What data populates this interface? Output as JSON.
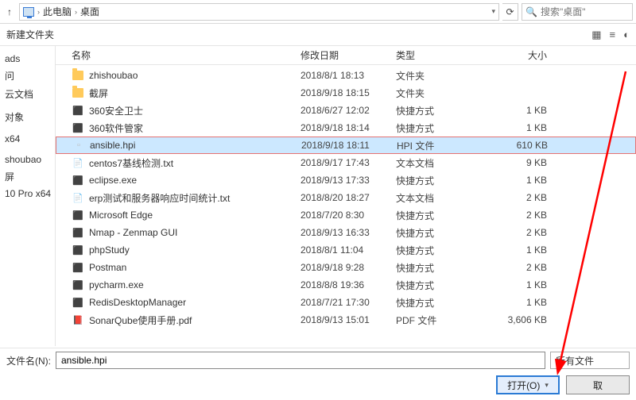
{
  "addressbar": {
    "root": "此电脑",
    "folder": "桌面",
    "search_placeholder": "搜索\"桌面\""
  },
  "toolbar": {
    "new_folder": "新建文件夹"
  },
  "sidebar": {
    "items": [
      "ads",
      "问",
      "云文档",
      "",
      "对象",
      "",
      "x64",
      "",
      "shoubao",
      "屏",
      " 10 Pro x64"
    ]
  },
  "columns": {
    "name": "名称",
    "date": "修改日期",
    "type": "类型",
    "size": "大小"
  },
  "files": [
    {
      "icon": "folder",
      "name": "zhishoubao",
      "date": "2018/8/1 18:13",
      "type": "文件夹",
      "size": ""
    },
    {
      "icon": "folder",
      "name": "截屏",
      "date": "2018/9/18 18:15",
      "type": "文件夹",
      "size": ""
    },
    {
      "icon": "app",
      "name": "360安全卫士",
      "date": "2018/6/27 12:02",
      "type": "快捷方式",
      "size": "1 KB"
    },
    {
      "icon": "app",
      "name": "360软件管家",
      "date": "2018/9/18 18:14",
      "type": "快捷方式",
      "size": "1 KB"
    },
    {
      "icon": "hpi",
      "name": "ansible.hpi",
      "date": "2018/9/18 18:11",
      "type": "HPI 文件",
      "size": "610 KB",
      "selected": true
    },
    {
      "icon": "txt",
      "name": "centos7基线检测.txt",
      "date": "2018/9/17 17:43",
      "type": "文本文档",
      "size": "9 KB"
    },
    {
      "icon": "app",
      "name": "eclipse.exe",
      "date": "2018/9/13 17:33",
      "type": "快捷方式",
      "size": "1 KB"
    },
    {
      "icon": "txt",
      "name": "erp测试和服务器响应时间统计.txt",
      "date": "2018/8/20 18:27",
      "type": "文本文档",
      "size": "2 KB"
    },
    {
      "icon": "app",
      "name": "Microsoft Edge",
      "date": "2018/7/20 8:30",
      "type": "快捷方式",
      "size": "2 KB"
    },
    {
      "icon": "app",
      "name": "Nmap - Zenmap GUI",
      "date": "2018/9/13 16:33",
      "type": "快捷方式",
      "size": "2 KB"
    },
    {
      "icon": "app",
      "name": "phpStudy",
      "date": "2018/8/1 11:04",
      "type": "快捷方式",
      "size": "1 KB"
    },
    {
      "icon": "app",
      "name": "Postman",
      "date": "2018/9/18 9:28",
      "type": "快捷方式",
      "size": "2 KB"
    },
    {
      "icon": "app",
      "name": "pycharm.exe",
      "date": "2018/8/8 19:36",
      "type": "快捷方式",
      "size": "1 KB"
    },
    {
      "icon": "app",
      "name": "RedisDesktopManager",
      "date": "2018/7/21 17:30",
      "type": "快捷方式",
      "size": "1 KB"
    },
    {
      "icon": "pdf",
      "name": "SonarQube使用手册.pdf",
      "date": "2018/9/13 15:01",
      "type": "PDF 文件",
      "size": "3,606 KB"
    }
  ],
  "footer": {
    "filename_label": "文件名(N):",
    "filename_value": "ansible.hpi",
    "filter_label": "所有文件",
    "open_btn": "打开(O)",
    "cancel_btn": "取"
  },
  "arrow": {
    "color": "#ff0000"
  }
}
